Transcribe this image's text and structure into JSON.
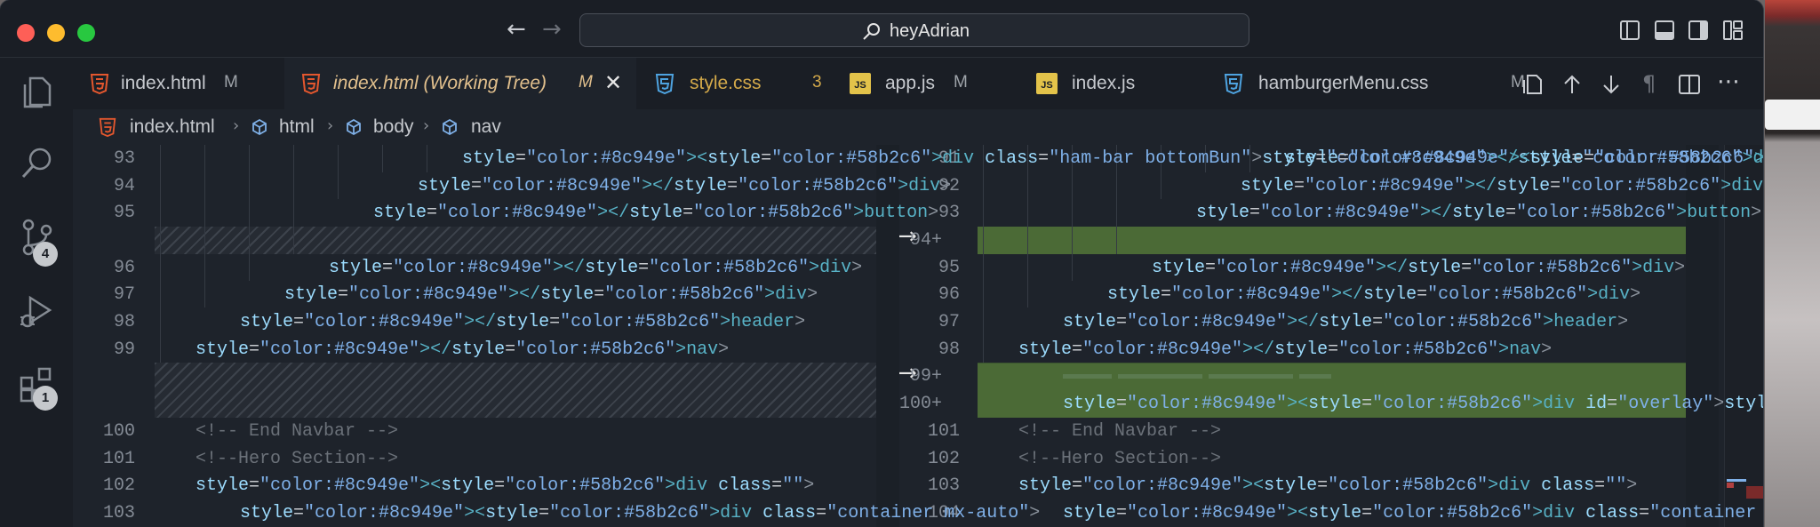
{
  "window": {
    "command_center": "heyAdrian"
  },
  "activity_bar": {
    "scm_badge": "4",
    "extensions_badge": "1"
  },
  "tabs": [
    {
      "label": "index.html",
      "status": "M",
      "icon": "html-file-icon",
      "status_color": "#9ea3a9"
    },
    {
      "label": "index.html (Working Tree)",
      "status": "M",
      "icon": "html-file-icon",
      "status_color": "#9ea3a9",
      "active": true
    },
    {
      "label": "style.css",
      "status": "3",
      "icon": "css-file-icon",
      "status_color": "#d3a94a"
    },
    {
      "label": "app.js",
      "status": "M",
      "icon": "js-file-icon",
      "status_color": "#9ea3a9"
    },
    {
      "label": "index.js",
      "status": "",
      "icon": "js-file-icon",
      "status_color": "#9ea3a9"
    },
    {
      "label": "hamburgerMenu.css",
      "status": "M",
      "icon": "css-file-icon",
      "status_color": "#9ea3a9"
    }
  ],
  "breadcrumb": [
    "index.html",
    "html",
    "body",
    "nav"
  ],
  "diff": {
    "left": {
      "line_numbers": [
        "93",
        "94",
        "95",
        "",
        "96",
        "97",
        "98",
        "99",
        "",
        "",
        "100",
        "101",
        "102",
        "103"
      ]
    },
    "right": {
      "line_numbers": [
        "91",
        "92",
        "93",
        "94+",
        "95",
        "96",
        "97",
        "98",
        "99+",
        "100+",
        "101",
        "102",
        "103",
        "104"
      ]
    },
    "code": {
      "l0": "<div class=\"ham-bar bottomBun\"></div>",
      "l1": "</div>",
      "l2": "</button>",
      "l4": "</div>",
      "l5": "</div>",
      "l6": "</header>",
      "l7": "</nav>",
      "l9": "<div id=\"overlay\"></div>",
      "l10": "<!-- End Navbar -->",
      "l11": "<!--Hero Section-->",
      "l12": "<div class=\"\">",
      "l13": "<div class=\"container mx-auto\">"
    }
  },
  "colors": {
    "added_line": "#4b6a36",
    "tag": "#58b2c6",
    "attribute": "#9cdcfe",
    "string": "#7fb0e8",
    "comment": "#6b7179"
  }
}
